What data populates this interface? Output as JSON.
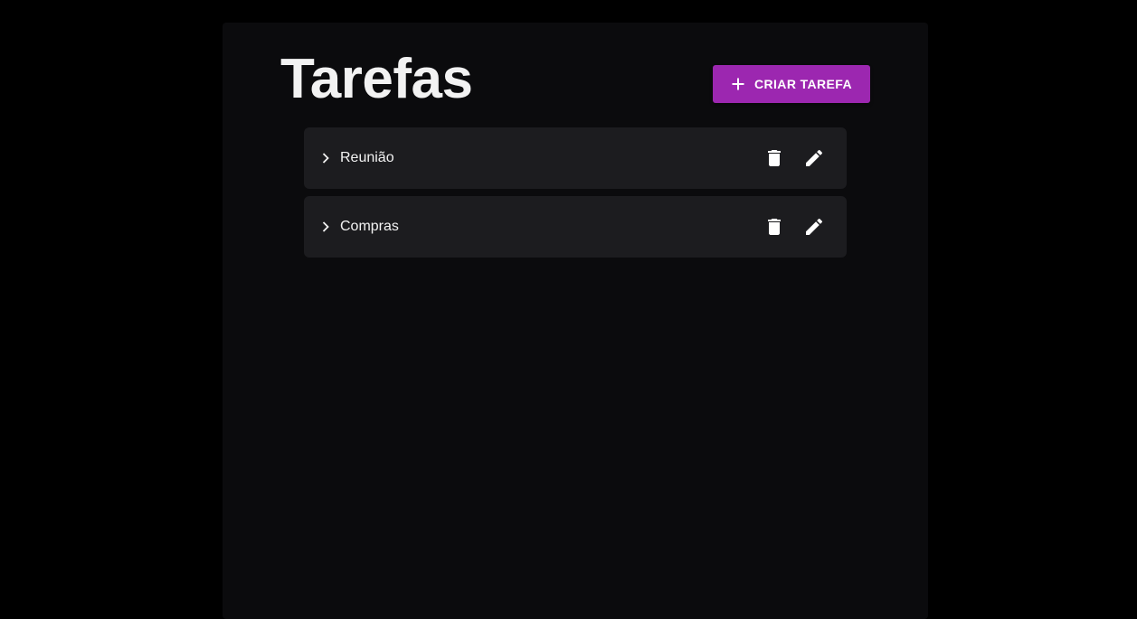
{
  "page": {
    "title": "Tarefas"
  },
  "toolbar": {
    "create_label": "CRIAR TAREFA",
    "create_icon": "plus-icon",
    "accent_color": "#9c27b0"
  },
  "tasks": [
    {
      "label": "Reunião",
      "expand_icon": "chevron-right-icon",
      "delete_icon": "trash-icon",
      "edit_icon": "pencil-icon"
    },
    {
      "label": "Compras",
      "expand_icon": "chevron-right-icon",
      "delete_icon": "trash-icon",
      "edit_icon": "pencil-icon"
    }
  ]
}
